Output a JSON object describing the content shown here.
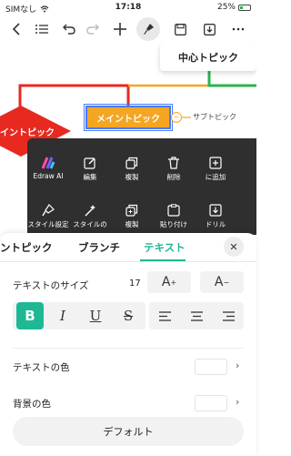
{
  "status_bar": {
    "carrier": "SIMなし",
    "time": "17:18",
    "battery": "25%"
  },
  "canvas": {
    "popup_label": "中心トピック",
    "left_topic": "イントピック",
    "main_topic": "メイントピック",
    "collapse_symbol": "−",
    "subtopic": "サブトピック",
    "colors": {
      "main": "#f4a623",
      "red": "#e8291f",
      "green": "#2bb24c",
      "select": "#4a7bf5"
    }
  },
  "context_menu": {
    "row1": [
      {
        "icon": "edraw-ai-icon",
        "label": "Edraw AI"
      },
      {
        "icon": "edit-icon",
        "label": "編集"
      },
      {
        "icon": "copy-icon",
        "label": "複製"
      },
      {
        "icon": "delete-icon",
        "label": "削除"
      },
      {
        "icon": "add-icon",
        "label": "に追加"
      }
    ],
    "row2": [
      {
        "icon": "format-painter-icon",
        "label": "スタイル設定"
      },
      {
        "icon": "magic-style-icon",
        "label": "スタイルの"
      },
      {
        "icon": "duplicate-icon",
        "label": "複製"
      },
      {
        "icon": "paste-icon",
        "label": "貼り付け"
      },
      {
        "icon": "drill-icon",
        "label": "ドリル"
      }
    ]
  },
  "sheet": {
    "tabs": [
      "ントピック",
      "ブランチ",
      "テキスト"
    ],
    "active_tab": "テキスト",
    "close": "✕",
    "text_size_label": "テキストのサイズ",
    "text_size_value": "17",
    "increase_label": "A",
    "increase_sup": "+",
    "decrease_label": "A",
    "decrease_sup": "−",
    "style_buttons": [
      "B",
      "I",
      "U",
      "S"
    ],
    "text_color_label": "テキストの色",
    "bg_color_label": "背景の色",
    "chevron": "›",
    "default_button": "デフォルト",
    "accent": "#1fb895"
  }
}
